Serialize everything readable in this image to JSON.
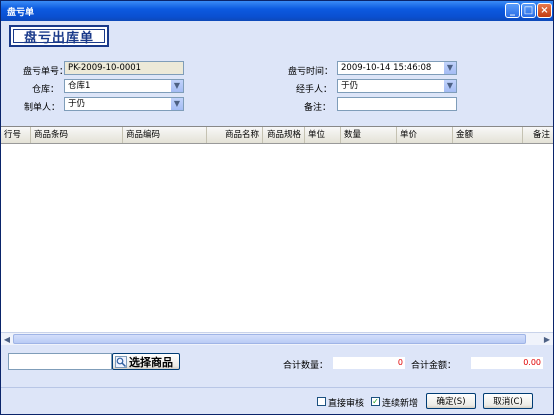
{
  "window": {
    "title": "盘亏单"
  },
  "title_buttons": {
    "minimize": "_",
    "maximize": "□",
    "close": "×"
  },
  "logo_text": "盘亏出库单",
  "form": {
    "no_label": "盘亏单号：",
    "no_value": "PK-2009-10-0001",
    "warehouse_label": "仓库：",
    "warehouse_value": "仓库1",
    "maker_label": "制单人：",
    "maker_value": "于仍",
    "time_label": "盘亏时间：",
    "time_value": "2009-10-14 15:46:08",
    "handler_label": "经手人：",
    "handler_value": "于仍",
    "remark_label": "备注：",
    "remark_value": ""
  },
  "grid": {
    "columns": [
      "行号",
      "商品条码",
      "商品编码",
      "商品名称",
      "商品规格",
      "单位",
      "数量",
      "单价",
      "金额",
      "备注"
    ],
    "rows": []
  },
  "select_goods_label": "选择商品",
  "totals": {
    "qty_label": "合计数量：",
    "qty_value": "0",
    "amount_label": "合计金额：",
    "amount_value": "0.00"
  },
  "footer": {
    "direct_audit_label": "直接审核",
    "direct_audit_checked": false,
    "continuous_add_label": "连续新增",
    "continuous_add_checked": true,
    "ok_label": "确定(S)",
    "cancel_label": "取消(C)"
  },
  "icons": {
    "dropdown": "chevron-down-icon",
    "search": "magnifier-icon",
    "check": "checkmark-icon"
  }
}
